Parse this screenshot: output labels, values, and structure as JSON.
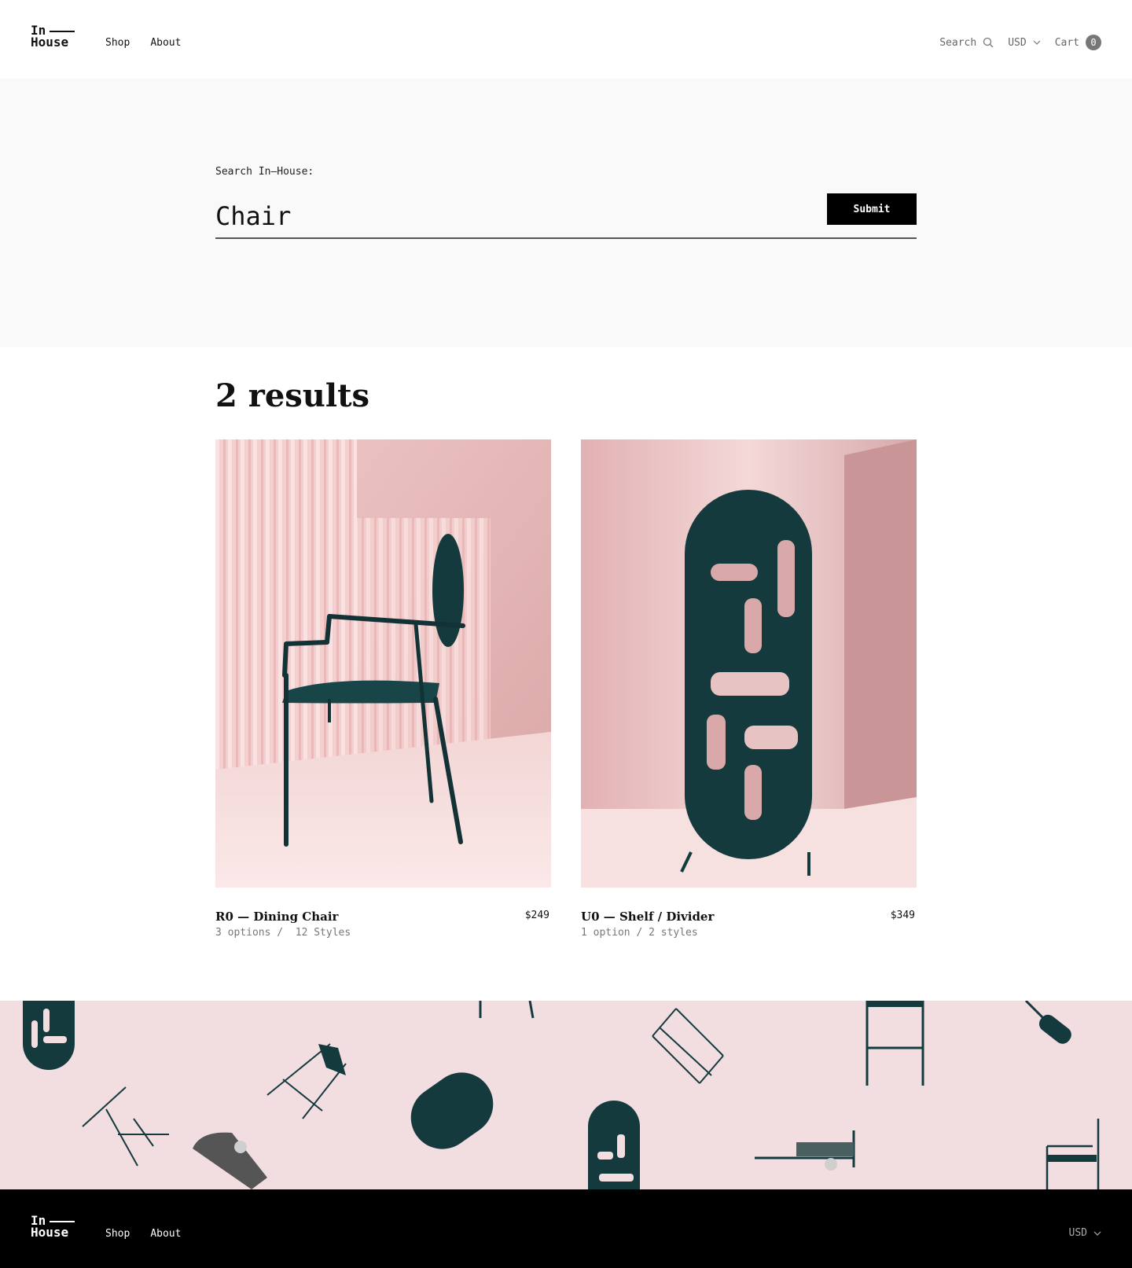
{
  "brand": {
    "line1": "In",
    "line2": "House"
  },
  "nav": {
    "shop": "Shop",
    "about": "About"
  },
  "header": {
    "search_label": "Search",
    "currency": "USD",
    "cart_label": "Cart",
    "cart_count": "0"
  },
  "search": {
    "label": "Search In—House:",
    "value": "Chair",
    "submit_label": "Submit"
  },
  "results": {
    "heading": "2 results",
    "items": [
      {
        "name": "R0 — Dining Chair",
        "price": "$249",
        "options": "3 options /  12 Styles"
      },
      {
        "name": "U0 — Shelf / Divider",
        "price": "$349",
        "options": "1 option / 2 styles"
      }
    ]
  },
  "footer": {
    "shop": "Shop",
    "about": "About",
    "currency": "USD"
  },
  "colors": {
    "accent": "#000000",
    "pink": "#f2dde1",
    "teal": "#143a3d"
  }
}
